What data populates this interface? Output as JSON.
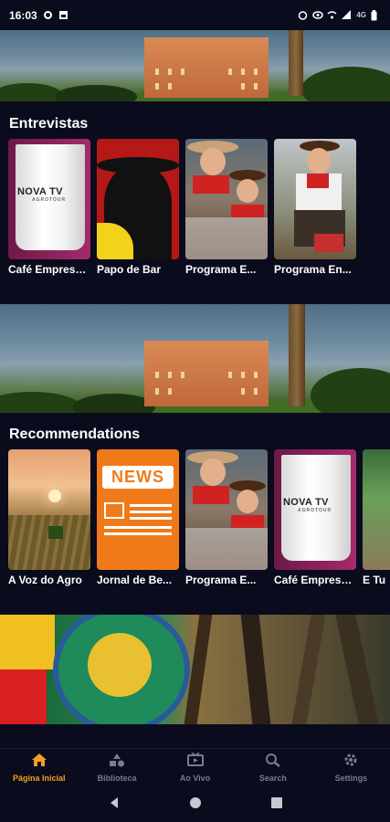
{
  "status_bar": {
    "time": "16:03",
    "left_icons": [
      "settings-icon",
      "image-icon"
    ],
    "right_icons": [
      "alarm-icon",
      "eye-icon",
      "wifi-call-icon",
      "signal-icon",
      "network-4g-icon",
      "battery-icon"
    ],
    "network": "4G"
  },
  "sections": [
    {
      "title": "Entrevistas",
      "items": [
        {
          "label": "Café Empresarial"
        },
        {
          "label": "Papo de Bar"
        },
        {
          "label": "Programa E..."
        },
        {
          "label": "Programa En..."
        }
      ]
    },
    {
      "title": "Recommendations",
      "items": [
        {
          "label": "A Voz do Agro"
        },
        {
          "label": "Jornal de Be..."
        },
        {
          "label": "Programa E..."
        },
        {
          "label": "Café Empresarial"
        },
        {
          "label": "E Tu"
        }
      ]
    }
  ],
  "thumbs": {
    "cup_brand": "NOVA TV",
    "cup_sub": "AGROTOUR",
    "news_word": "NEWS"
  },
  "bottom_nav": [
    {
      "label": "Página Inicial",
      "icon": "home-icon",
      "active": true
    },
    {
      "label": "Biblioteca",
      "icon": "library-icon",
      "active": false
    },
    {
      "label": "Ao Vivo",
      "icon": "live-tv-icon",
      "active": false
    },
    {
      "label": "Search",
      "icon": "search-icon",
      "active": false
    },
    {
      "label": "Settings",
      "icon": "gear-icon",
      "active": false
    }
  ],
  "system_nav": [
    "back-icon",
    "home-circle-icon",
    "recents-icon"
  ],
  "colors": {
    "background": "#0b0b1e",
    "accent": "#f0a020",
    "inactive": "#7a7a90"
  }
}
